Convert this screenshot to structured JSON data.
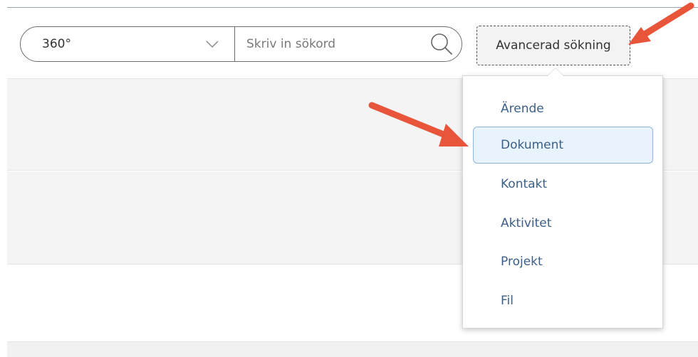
{
  "search": {
    "scope_value": "360°",
    "placeholder": "Skriv in sökord"
  },
  "advanced_search": {
    "label": "Avancerad sökning"
  },
  "menu": {
    "items": [
      {
        "label": "Ärende"
      },
      {
        "label": "Dokument"
      },
      {
        "label": "Kontakt"
      },
      {
        "label": "Aktivitet"
      },
      {
        "label": "Projekt"
      },
      {
        "label": "Fil"
      }
    ],
    "selected": "Dokument"
  },
  "colors": {
    "menu_text": "#3b5f86",
    "selected_bg": "#e9f3fd",
    "selected_border": "#8fb6df",
    "annotation_arrow": "#e8553b"
  },
  "icons": {
    "scope_chevron": "chevron-down-icon",
    "search": "search-icon",
    "annotation": "annotation-arrow-icon"
  }
}
